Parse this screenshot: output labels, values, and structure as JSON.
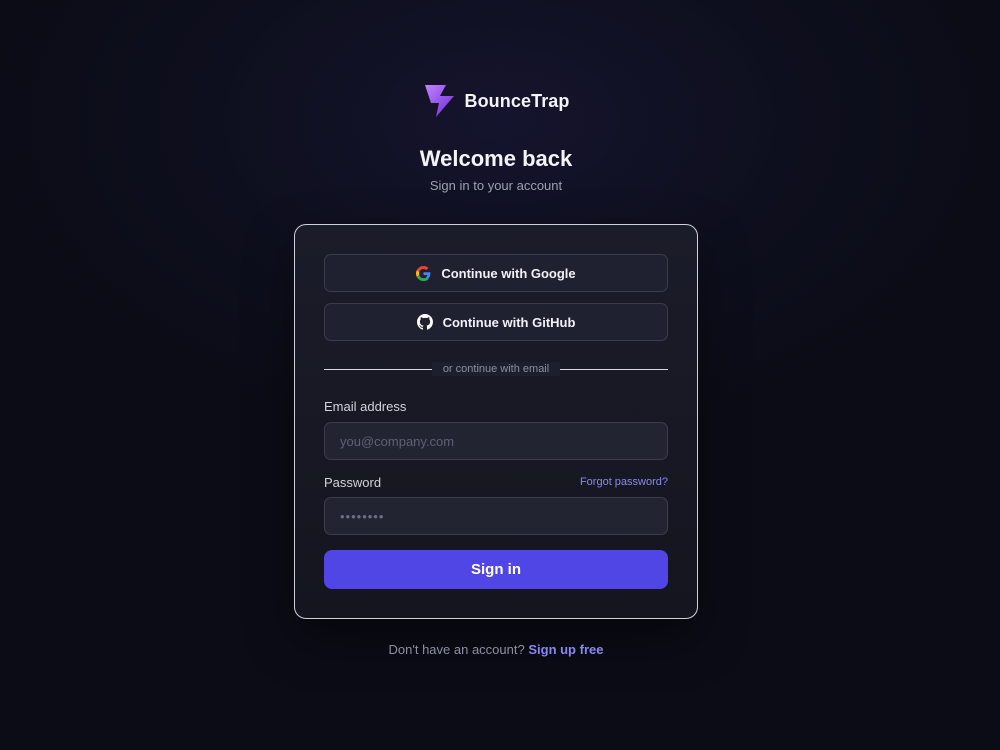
{
  "brand": {
    "name": "BounceTrap",
    "logo_icon": "lightning-bolt-icon",
    "logo_colors": [
      "#a855f7",
      "#6d28d9"
    ]
  },
  "header": {
    "title": "Welcome back",
    "subtitle": "Sign in to your account"
  },
  "oauth": {
    "google_label": "Continue with Google",
    "google_icon": "google-icon",
    "github_label": "Continue with GitHub",
    "github_icon": "github-icon"
  },
  "divider": {
    "text": "or continue with email"
  },
  "form": {
    "email_label": "Email address",
    "email_placeholder": "you@company.com",
    "email_value": "",
    "password_label": "Password",
    "password_placeholder": "••••••••",
    "password_value": "",
    "forgot_label": "Forgot password?",
    "submit_label": "Sign in"
  },
  "footer": {
    "prompt": "Don't have an account?",
    "signup_label": "Sign up free"
  },
  "colors": {
    "accent": "#4f46e5",
    "link": "#8b86f2",
    "background": "#0e0f1e"
  }
}
